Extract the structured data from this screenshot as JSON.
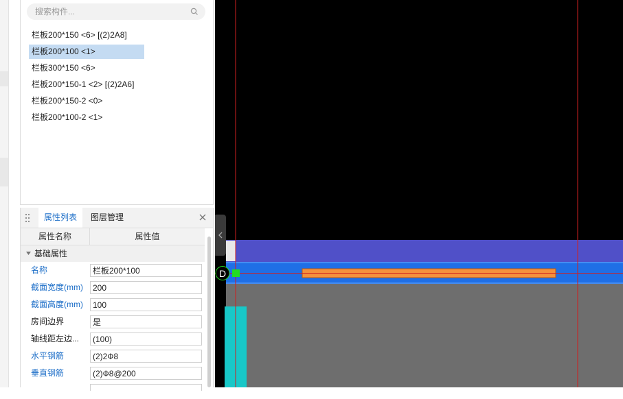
{
  "search": {
    "placeholder": "搜索构件..."
  },
  "components": [
    {
      "label": "栏板200*150 <6> [(2)2A8]",
      "selected": false
    },
    {
      "label": "栏板200*100 <1>",
      "selected": true
    },
    {
      "label": "栏板300*150 <6>",
      "selected": false
    },
    {
      "label": "栏板200*150-1 <2> [(2)2A6]",
      "selected": false
    },
    {
      "label": "栏板200*150-2 <0>",
      "selected": false
    },
    {
      "label": "栏板200*100-2 <1>",
      "selected": false
    }
  ],
  "property_panel": {
    "tabs": [
      {
        "label": "属性列表",
        "active": true
      },
      {
        "label": "图层管理",
        "active": false
      }
    ],
    "headers": {
      "name": "属性名称",
      "value": "属性值"
    },
    "section": "基础属性",
    "rows": [
      {
        "name": "名称",
        "value": "栏板200*100",
        "blue": true
      },
      {
        "name": "截面宽度(mm)",
        "value": "200",
        "blue": true
      },
      {
        "name": "截面高度(mm)",
        "value": "100",
        "blue": true
      },
      {
        "name": "房间边界",
        "value": "是",
        "blue": false
      },
      {
        "name": "轴线距左边...",
        "value": "(100)",
        "blue": false
      },
      {
        "name": "水平钢筋",
        "value": "(2)2Ф8",
        "blue": true
      },
      {
        "name": "垂直钢筋",
        "value": "(2)Ф8@200",
        "blue": true
      }
    ]
  },
  "canvas": {
    "axis_label": "D",
    "colors": {
      "background": "#000000",
      "slab_upper": "#5050c8",
      "slab_lower": "#1f6fe6",
      "rebar": "#f5913c",
      "floor": "#6e6e6e",
      "column": "#18c8c8",
      "axis_line": "#d01f1f",
      "marker": "#22dd22"
    }
  }
}
